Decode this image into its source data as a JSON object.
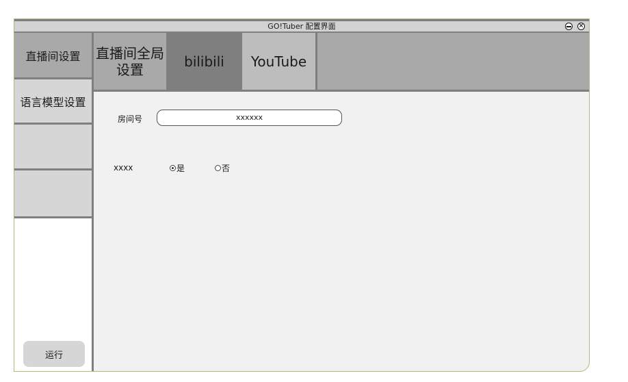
{
  "window": {
    "title": "GO!Tuber 配置界面"
  },
  "sidebar": {
    "items": [
      {
        "label": "直播间设置"
      },
      {
        "label": "语言模型设置"
      },
      {
        "label": ""
      },
      {
        "label": ""
      }
    ],
    "run_button": "运行"
  },
  "tabs": [
    {
      "label": "直播间全局设置"
    },
    {
      "label": "bilibili"
    },
    {
      "label": "YouTube"
    }
  ],
  "form": {
    "room_label": "房间号",
    "room_value": "xxxxxx",
    "option_label": "xxxx",
    "radio_yes": "是",
    "radio_no": "否",
    "selected": "是"
  }
}
